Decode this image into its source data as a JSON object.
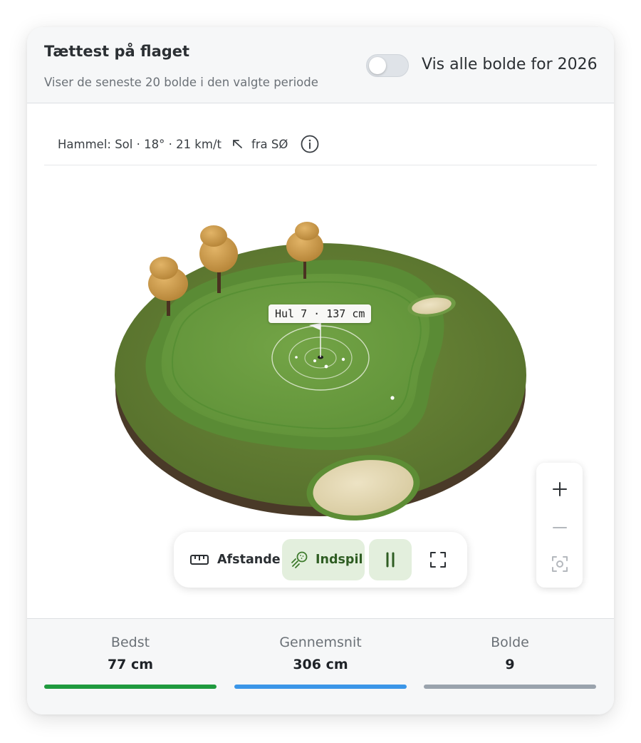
{
  "header": {
    "title": "Tættest på flaget",
    "subtitle": "Viser de seneste 20 bolde i den valgte periode",
    "toggle_label": "Vis alle bolde for 2026",
    "toggle_on": false
  },
  "weather": {
    "text": "Hammel: Sol · 18° · 21 km/t",
    "wind_direction": "fra SØ",
    "wind_icon": "arrow-up-left-icon",
    "info_icon": "info-circle-icon"
  },
  "scene": {
    "tooltip": "Hul 7 · 137 cm"
  },
  "zoom": {
    "zoom_in_icon": "plus-icon",
    "zoom_out_icon": "minus-icon",
    "focus_icon": "focus-icon"
  },
  "toolbar": {
    "distances_label": "Afstande",
    "approach_label": "Indspil",
    "pause_icon": "pause-icon",
    "fullscreen_icon": "fullscreen-icon"
  },
  "stats": [
    {
      "label": "Bedst",
      "value": "77 cm",
      "color": "#1f9a3e"
    },
    {
      "label": "Gennemsnit",
      "value": "306 cm",
      "color": "#3b96e8"
    },
    {
      "label": "Bolde",
      "value": "9",
      "color": "#9aa3ad"
    }
  ]
}
